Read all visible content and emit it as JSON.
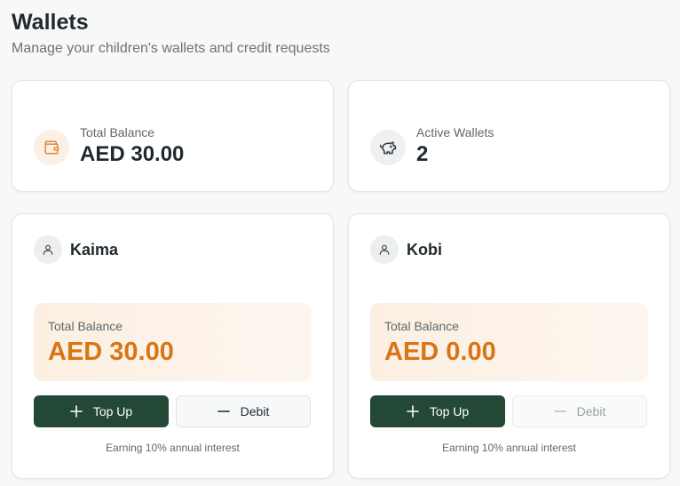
{
  "header": {
    "title": "Wallets",
    "subtitle": "Manage your children's wallets and credit requests"
  },
  "stats": {
    "total_balance": {
      "label": "Total Balance",
      "value": "AED 30.00",
      "icon": "wallet-icon"
    },
    "active_wallets": {
      "label": "Active Wallets",
      "value": "2",
      "icon": "piggy-bank-icon"
    }
  },
  "wallets": [
    {
      "name": "Kaima",
      "balance_label": "Total Balance",
      "balance": "AED 30.00",
      "topup_label": "Top Up",
      "debit_label": "Debit",
      "debit_enabled": true,
      "interest_note": "Earning 10% annual interest"
    },
    {
      "name": "Kobi",
      "balance_label": "Total Balance",
      "balance": "AED 0.00",
      "topup_label": "Top Up",
      "debit_label": "Debit",
      "debit_enabled": false,
      "interest_note": "Earning 10% annual interest"
    }
  ],
  "colors": {
    "accent_orange": "#d97514",
    "button_green": "#234936",
    "text_dark": "#1f2a2e",
    "text_muted": "#5f686d"
  }
}
